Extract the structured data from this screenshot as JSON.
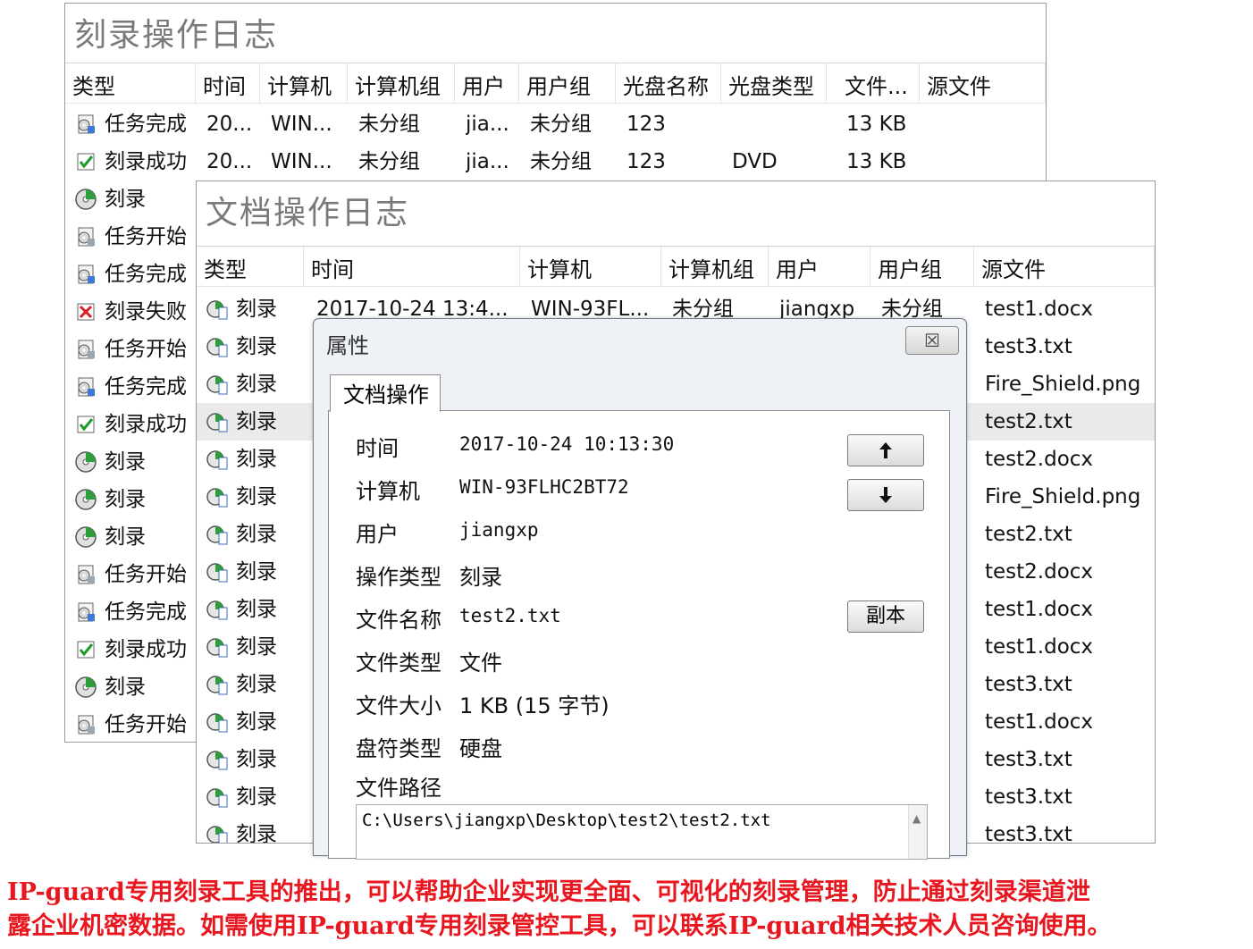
{
  "burn_log": {
    "title": "刻录操作日志",
    "columns": [
      "类型",
      "时间",
      "计算机",
      "计算机组",
      "用户",
      "用户组",
      "光盘名称",
      "光盘类型",
      "文件...",
      "源文件"
    ],
    "rows": [
      {
        "type": "任务完成",
        "icon": "task-complete-icon",
        "time": "20...",
        "computer": "WIN...",
        "group": "未分组",
        "user": "jia...",
        "user_group": "未分组",
        "disc_name": "123",
        "disc_type": "",
        "file_size": "13 KB"
      },
      {
        "type": "刻录成功",
        "icon": "burn-success-icon",
        "time": "20...",
        "computer": "WIN...",
        "group": "未分组",
        "user": "jia...",
        "user_group": "未分组",
        "disc_name": "123",
        "disc_type": "DVD",
        "file_size": "13 KB"
      },
      {
        "type": "刻录",
        "icon": "burn-disc-icon"
      },
      {
        "type": "任务开始",
        "icon": "task-start-icon"
      },
      {
        "type": "任务完成",
        "icon": "task-complete-icon"
      },
      {
        "type": "刻录失败",
        "icon": "burn-fail-icon"
      },
      {
        "type": "任务开始",
        "icon": "task-start-icon"
      },
      {
        "type": "任务完成",
        "icon": "task-complete-icon"
      },
      {
        "type": "刻录成功",
        "icon": "burn-success-icon"
      },
      {
        "type": "刻录",
        "icon": "burn-disc-icon"
      },
      {
        "type": "刻录",
        "icon": "burn-disc-icon"
      },
      {
        "type": "刻录",
        "icon": "burn-disc-icon"
      },
      {
        "type": "任务开始",
        "icon": "task-start-icon"
      },
      {
        "type": "任务完成",
        "icon": "task-complete-icon"
      },
      {
        "type": "刻录成功",
        "icon": "burn-success-icon"
      },
      {
        "type": "刻录",
        "icon": "burn-disc-icon"
      },
      {
        "type": "任务开始",
        "icon": "task-start-icon"
      }
    ]
  },
  "doc_log": {
    "title": "文档操作日志",
    "columns": [
      "类型",
      "时间",
      "计算机",
      "计算机组",
      "用户",
      "用户组",
      "源文件"
    ],
    "first_row": {
      "type": "刻录",
      "time": "2017-10-24 13:4...",
      "computer": "WIN-93FL...",
      "group": "未分组",
      "user": "jiangxp",
      "user_group": "未分组"
    },
    "type_label": "刻录",
    "source_files": [
      "test1.docx",
      "test3.txt",
      "Fire_Shield.png",
      "test2.txt",
      "test2.docx",
      "Fire_Shield.png",
      "test2.txt",
      "test2.docx",
      "test1.docx",
      "test1.docx",
      "test3.txt",
      "test1.docx",
      "test3.txt",
      "test3.txt",
      "test3.txt"
    ],
    "selected_index": 3
  },
  "dialog": {
    "title": "属性",
    "close": "☒",
    "tab": "文档操作",
    "fields": [
      {
        "label": "时间",
        "value": "2017-10-24 10:13:30"
      },
      {
        "label": "计算机",
        "value": "WIN-93FLHC2BT72"
      },
      {
        "label": "用户",
        "value": "jiangxp"
      },
      {
        "label": "操作类型",
        "value": "刻录"
      },
      {
        "label": "文件名称",
        "value": "test2.txt"
      },
      {
        "label": "文件类型",
        "value": "文件"
      },
      {
        "label": "文件大小",
        "value": "1 KB (15 字节)"
      },
      {
        "label": "盘符类型",
        "value": "硬盘"
      },
      {
        "label": "文件路径",
        "value": ""
      }
    ],
    "path": "C:\\Users\\jiangxp\\Desktop\\test2\\test2.txt",
    "up_button": "🡅",
    "down_button": "🡇",
    "copy_button": "副本"
  },
  "caption": {
    "line1": "IP-guard专用刻录工具的推出，可以帮助企业实现更全面、可视化的刻录管理，防止通过刻录渠道泄",
    "line2": "露企业机密数据。如需使用IP-guard专用刻录管控工具，可以联系IP-guard相关技术人员咨询使用。"
  },
  "colors": {
    "caption": "#e8161e",
    "title_gray": "#7a7a7a",
    "selected_row": "#eaeaea"
  }
}
